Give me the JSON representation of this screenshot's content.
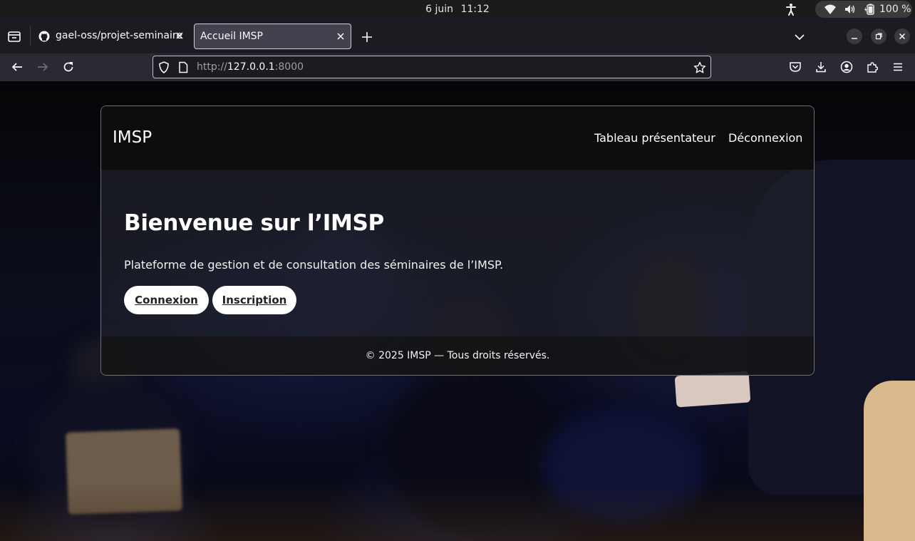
{
  "os": {
    "date": "6 juin",
    "time": "11:12",
    "battery": "100 %"
  },
  "browser": {
    "tabs": [
      {
        "label": "gael-oss/projet-seminaire",
        "active": false
      },
      {
        "label": "Accueil IMSP",
        "active": true
      }
    ],
    "url_scheme": "http://",
    "url_host": "127.0.0.1",
    "url_port": ":8000"
  },
  "site": {
    "brand": "IMSP",
    "nav": [
      "Tableau présentateur",
      "Déconnexion"
    ],
    "hero_title": "Bienvenue sur l’IMSP",
    "hero_text": "Plateforme de gestion et de consultation des séminaires de l’IMSP.",
    "buttons": [
      "Connexion",
      "Inscription"
    ],
    "footer": "© 2025 IMSP — Tous droits réservés."
  },
  "colors": {
    "tab_active_bg": "#42414d",
    "toolbar_bg": "#2b2a33",
    "card_header_bg": "#0d0d0d",
    "button_bg": "#ffffff"
  }
}
